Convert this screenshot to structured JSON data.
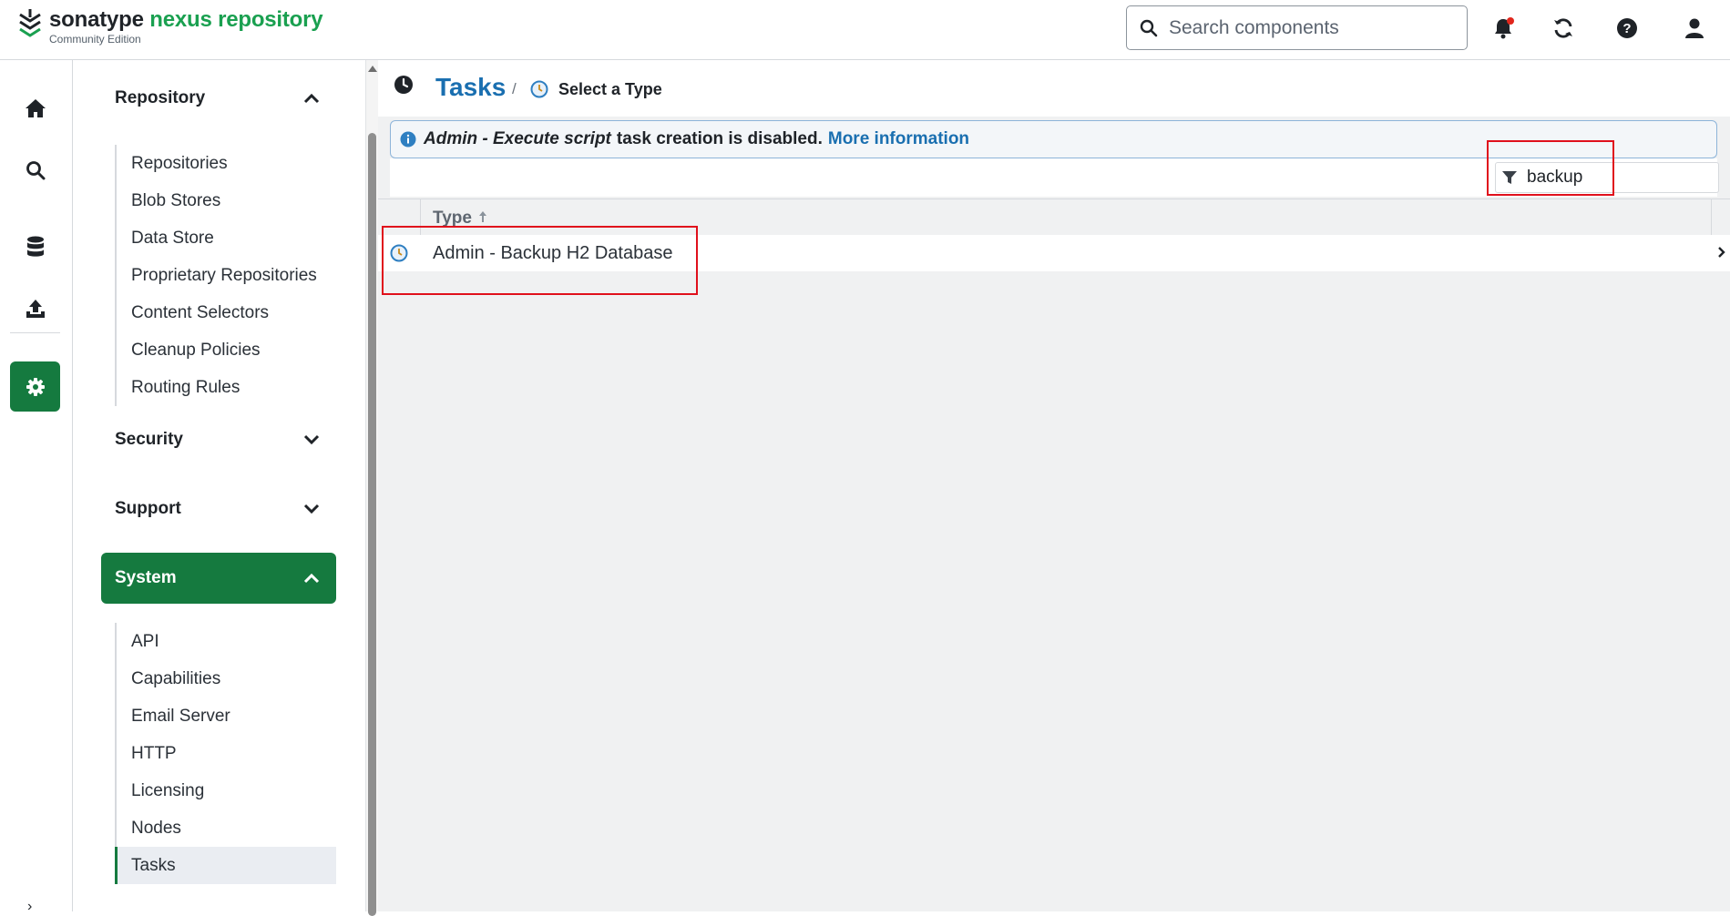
{
  "header": {
    "brand": "sonatype",
    "product": "nexus repository",
    "edition": "Community Edition",
    "search_placeholder": "Search components",
    "icons": [
      "notifications-icon",
      "refresh-icon",
      "help-icon",
      "user-icon"
    ],
    "colors": {
      "brand_green": "#1aa050",
      "notification_dot": "#e1261c"
    }
  },
  "rail": {
    "items": [
      "home-icon",
      "search-icon",
      "database-icon",
      "upload-icon",
      "settings-icon"
    ],
    "active": "settings-icon"
  },
  "sidebar": {
    "sections": [
      {
        "label": "Repository",
        "expanded": true,
        "items": [
          "Repositories",
          "Blob Stores",
          "Data Store",
          "Proprietary Repositories",
          "Content Selectors",
          "Cleanup Policies",
          "Routing Rules"
        ]
      },
      {
        "label": "Security",
        "expanded": false,
        "items": []
      },
      {
        "label": "Support",
        "expanded": false,
        "items": []
      },
      {
        "label": "System",
        "expanded": true,
        "active": true,
        "items": [
          "API",
          "Capabilities",
          "Email Server",
          "HTTP",
          "Licensing",
          "Nodes",
          "Tasks"
        ]
      }
    ],
    "active_item": "Tasks",
    "colors": {
      "active_green": "#157a3f"
    }
  },
  "breadcrumb": {
    "title": "Tasks",
    "separator": "/",
    "current": "Select a Type"
  },
  "notice": {
    "emphasis": "Admin - Execute script",
    "text": "task creation is disabled.",
    "link": "More information"
  },
  "filter": {
    "value": "backup"
  },
  "grid": {
    "column_header": "Type",
    "sort": "ascending",
    "rows": [
      "Admin - Backup H2 Database"
    ]
  }
}
